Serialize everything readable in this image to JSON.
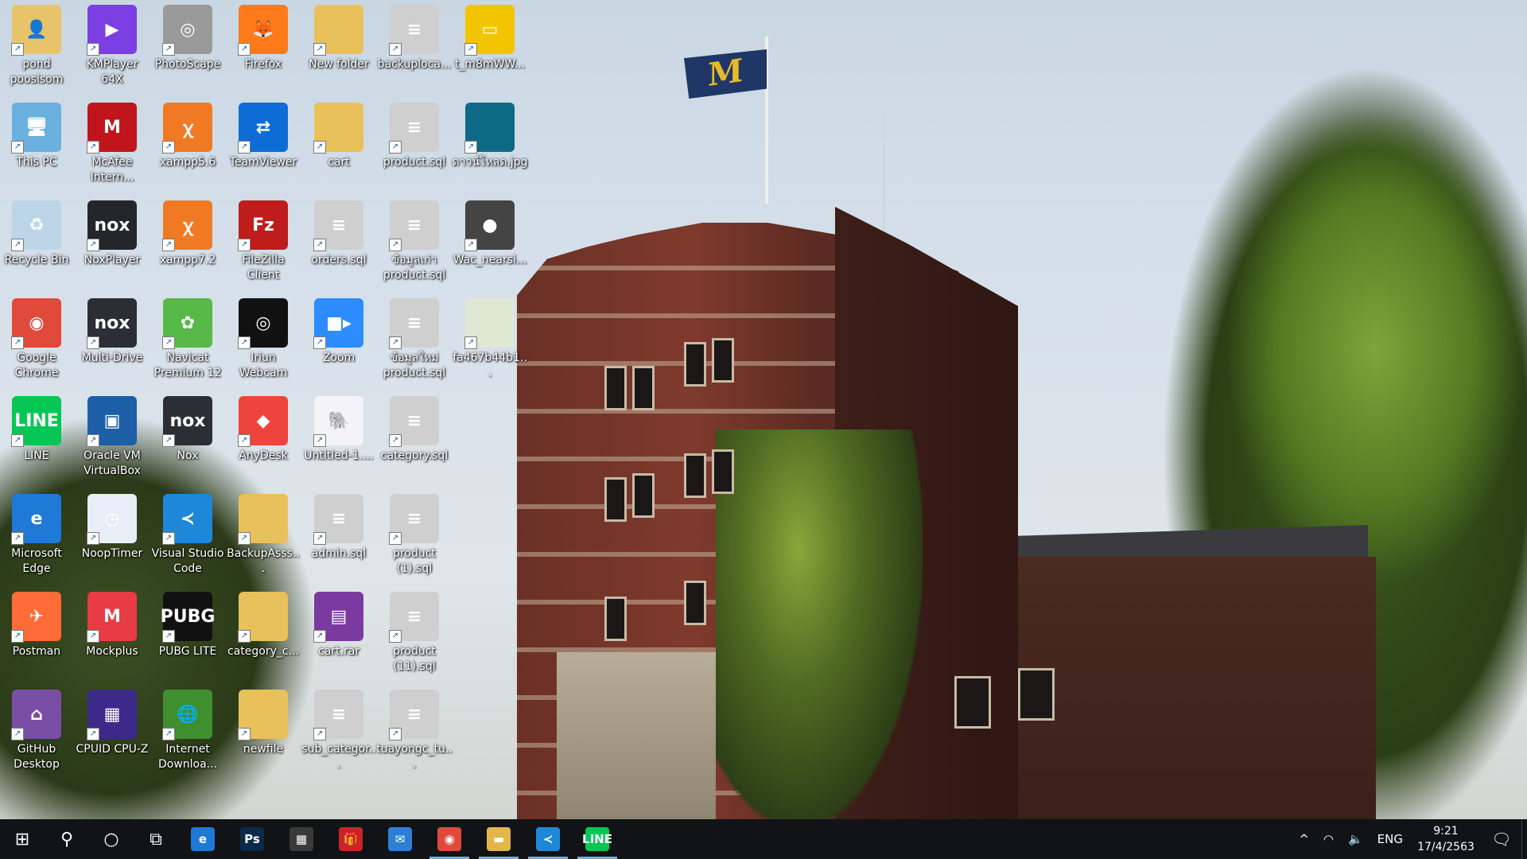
{
  "desktop": {
    "icons": [
      {
        "label": "pond poosisom",
        "art": "👤",
        "color": "#e7c36a"
      },
      {
        "label": "KMPlayer 64X",
        "art": "▶",
        "color": "#7b3fe4"
      },
      {
        "label": "PhotoScape",
        "art": "◎",
        "color": "#9a9a9a"
      },
      {
        "label": "Firefox",
        "art": "🦊",
        "color": "#ff7a1a"
      },
      {
        "label": "New folder",
        "art": "",
        "color": "#e9c15a"
      },
      {
        "label": "backuploca...",
        "art": "≡",
        "color": "#cfcfcf"
      },
      {
        "label": "t_m8mWW...",
        "art": "▭",
        "color": "#f2c500"
      },
      {
        "label": "This PC",
        "art": "🖥",
        "color": "#6ab0de"
      },
      {
        "label": "McAfee Intern...",
        "art": "M",
        "color": "#c0161b"
      },
      {
        "label": "xampp5.6",
        "art": "ꭓ",
        "color": "#f07a24"
      },
      {
        "label": "TeamViewer",
        "art": "⇄",
        "color": "#0e6cd6"
      },
      {
        "label": "cart",
        "art": "",
        "color": "#e9c15a"
      },
      {
        "label": "product.sql",
        "art": "≡",
        "color": "#cfcfcf"
      },
      {
        "label": "ดาวน์โหลด.jpg",
        "art": "",
        "color": "#0c6a86"
      },
      {
        "label": "Recycle Bin",
        "art": "♻",
        "color": "#bcd6e8"
      },
      {
        "label": "NoxPlayer",
        "art": "nox",
        "color": "#23262b"
      },
      {
        "label": "xampp7.2",
        "art": "ꭓ",
        "color": "#f07a24"
      },
      {
        "label": "FileZilla Client",
        "art": "Fz",
        "color": "#bf1c1c"
      },
      {
        "label": "orders.sql",
        "art": "≡",
        "color": "#cfcfcf"
      },
      {
        "label": "ข้อมูลเก่า product.sql",
        "art": "≡",
        "color": "#cfcfcf"
      },
      {
        "label": "Wac_nearsi...",
        "art": "●",
        "color": "#444444"
      },
      {
        "label": "Google Chrome",
        "art": "◉",
        "color": "#e04a3b"
      },
      {
        "label": "Multi-Drive",
        "art": "nox",
        "color": "#2b2e35"
      },
      {
        "label": "Navicat Premium 12",
        "art": "✿",
        "color": "#57b947"
      },
      {
        "label": "Iriun Webcam",
        "art": "◎",
        "color": "#111111"
      },
      {
        "label": "Zoom",
        "art": "■▸",
        "color": "#2d8cff"
      },
      {
        "label": "ข้อมูลใหม่ product.sql",
        "art": "≡",
        "color": "#cfcfcf"
      },
      {
        "label": "fa467b44b1...",
        "art": "",
        "color": "#dfe8d3"
      },
      {
        "label": "LINE",
        "art": "LINE",
        "color": "#06c755"
      },
      {
        "label": "Oracle VM VirtualBox",
        "art": "▣",
        "color": "#1d5fa6"
      },
      {
        "label": "Nox",
        "art": "nox",
        "color": "#2b2e35"
      },
      {
        "label": "AnyDesk",
        "art": "◆",
        "color": "#ef443b"
      },
      {
        "label": "Untitled-1....",
        "art": "🐘",
        "color": "#f3f3f8"
      },
      {
        "label": "category.sql",
        "art": "≡",
        "color": "#cfcfcf"
      },
      {
        "label": "Microsoft Edge",
        "art": "e",
        "color": "#1f79d6"
      },
      {
        "label": "NoopTimer",
        "art": "◷",
        "color": "#e8eef8"
      },
      {
        "label": "Visual Studio Code",
        "art": "≺",
        "color": "#1e88d8"
      },
      {
        "label": "BackupAsss...",
        "art": "",
        "color": "#e9c15a"
      },
      {
        "label": "admin.sql",
        "art": "≡",
        "color": "#cfcfcf"
      },
      {
        "label": "product (1).sql",
        "art": "≡",
        "color": "#cfcfcf"
      },
      {
        "label": "Postman",
        "art": "✈",
        "color": "#ff6c37"
      },
      {
        "label": "Mockplus",
        "art": "M",
        "color": "#e83b44"
      },
      {
        "label": "PUBG LITE",
        "art": "PUBG",
        "color": "#111111"
      },
      {
        "label": "category_c...",
        "art": "",
        "color": "#e9c15a"
      },
      {
        "label": "cart.rar",
        "art": "▤",
        "color": "#7a3aa0"
      },
      {
        "label": "product (11).sql",
        "art": "≡",
        "color": "#cfcfcf"
      },
      {
        "label": "GitHub Desktop",
        "art": "⌂",
        "color": "#7a4ea5"
      },
      {
        "label": "CPUID CPU-Z",
        "art": "▦",
        "color": "#3b2a8a"
      },
      {
        "label": "Internet Downloa...",
        "art": "🌐",
        "color": "#3f8f2e"
      },
      {
        "label": "newfile",
        "art": "",
        "color": "#e9c15a"
      },
      {
        "label": "sub_categor...",
        "art": "≡",
        "color": "#cfcfcf"
      },
      {
        "label": "tuayongc_tu...",
        "art": "≡",
        "color": "#cfcfcf"
      }
    ]
  },
  "taskbar": {
    "start_icon": "⊞",
    "search_icon": "⚲",
    "cortana_icon": "○",
    "taskview_icon": "⧉",
    "apps": [
      {
        "name": "edge",
        "glyph": "e",
        "color": "#1f79d6",
        "running": false
      },
      {
        "name": "photoshop",
        "glyph": "Ps",
        "color": "#0b2a4a",
        "running": false
      },
      {
        "name": "store",
        "glyph": "▦",
        "color": "#3a3a3a",
        "running": false
      },
      {
        "name": "gift",
        "glyph": "🎁",
        "color": "#c8242a",
        "running": false
      },
      {
        "name": "mail",
        "glyph": "✉",
        "color": "#2d7fd6",
        "running": false
      },
      {
        "name": "chrome",
        "glyph": "◉",
        "color": "#e04a3b",
        "running": true
      },
      {
        "name": "file-explorer",
        "glyph": "▬",
        "color": "#e3b64a",
        "running": true
      },
      {
        "name": "vscode",
        "glyph": "≺",
        "color": "#1e88d8",
        "running": true
      },
      {
        "name": "line",
        "glyph": "LINE",
        "color": "#06c755",
        "running": true
      }
    ],
    "tray": {
      "chevron": "^",
      "network_icon": "◠",
      "volume_icon": "🔈",
      "language": "ENG",
      "time": "9:21",
      "date": "17/4/2563",
      "notification_icon": "🗨"
    }
  }
}
